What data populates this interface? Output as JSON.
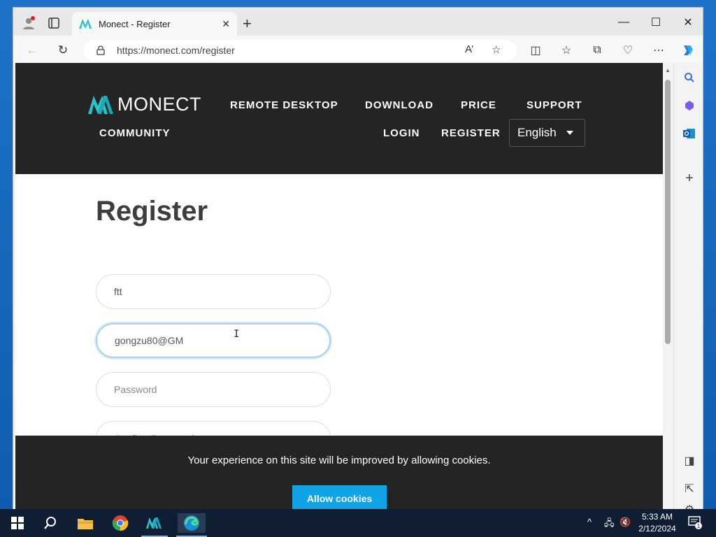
{
  "browser": {
    "tab_title": "Monect - Register",
    "url": "https://monect.com/register"
  },
  "site": {
    "logo_text": "MONECT",
    "nav": {
      "remote_desktop": "REMOTE DESKTOP",
      "download": "DOWNLOAD",
      "price": "PRICE",
      "support": "SUPPORT",
      "community": "COMMUNITY",
      "login": "LOGIN",
      "register": "REGISTER"
    },
    "language": "English"
  },
  "form": {
    "title": "Register",
    "username_value": "ftt",
    "email_value": "gongzu80@GM",
    "password_placeholder": "Password",
    "confirm_placeholder": "Confirm Password"
  },
  "cookie": {
    "message": "Your experience on this site will be improved by allowing cookies.",
    "button": "Allow cookies"
  },
  "taskbar": {
    "time": "5:33 AM",
    "date": "2/12/2024",
    "notification_count": "1"
  },
  "colors": {
    "header_bg": "#242424",
    "accent": "#0fa3e8",
    "logo_teal": "#29c4c8"
  }
}
